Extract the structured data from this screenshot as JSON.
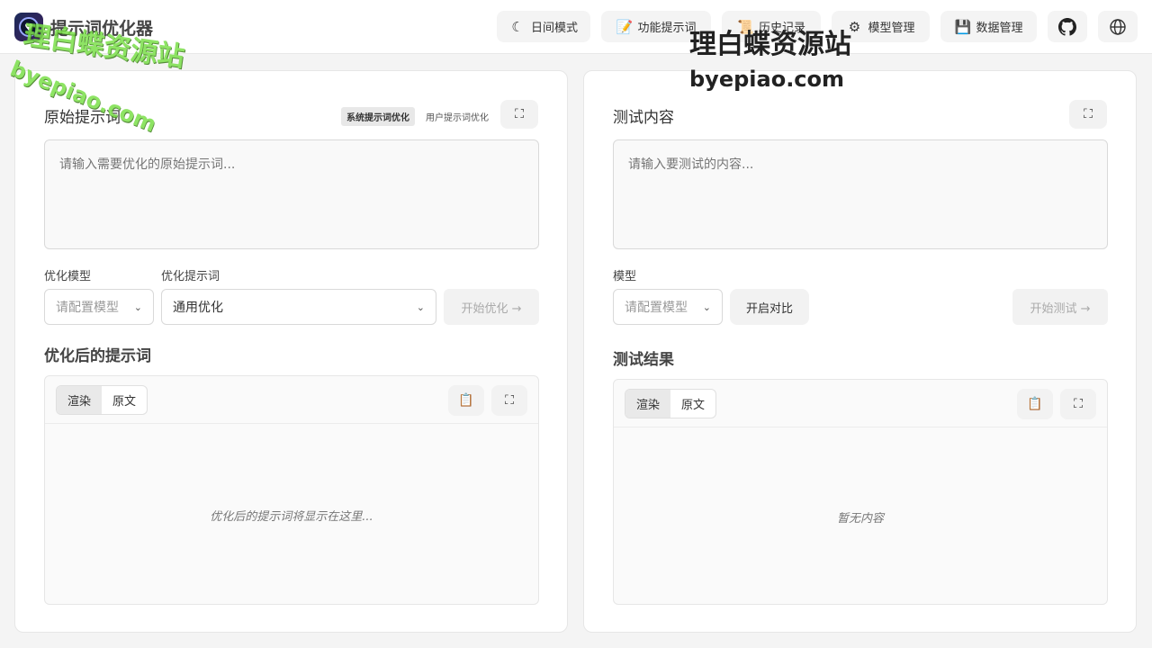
{
  "app": {
    "title": "提示词优化器"
  },
  "nav": {
    "day_mode": "日间模式",
    "feature_prompts": "功能提示词",
    "history": "历史记录",
    "model_manage": "模型管理",
    "data_manage": "数据管理"
  },
  "left": {
    "title": "原始提示词",
    "mode_tabs": [
      "系统提示词优化",
      "用户提示词优化"
    ],
    "input_placeholder": "请输入需要优化的原始提示词...",
    "model_label": "优化模型",
    "prompt_label": "优化提示词",
    "model_select": "请配置模型",
    "prompt_select": "通用优化",
    "start_button": "开始优化 →",
    "result_title": "优化后的提示词",
    "view_render": "渲染",
    "view_raw": "原文",
    "empty": "优化后的提示词将显示在这里..."
  },
  "right": {
    "title": "测试内容",
    "input_placeholder": "请输入要测试的内容...",
    "model_label": "模型",
    "model_select": "请配置模型",
    "compare_button": "开启对比",
    "start_button": "开始测试 →",
    "result_title": "测试结果",
    "view_render": "渲染",
    "view_raw": "原文",
    "empty": "暂无内容"
  },
  "watermark": {
    "text1": "理白蝶资源站",
    "text2": "byepiao.com"
  },
  "icons": {
    "moon": "moon-icon",
    "memo": "memo-icon",
    "scroll": "scroll-icon",
    "gear": "gear-icon",
    "floppy": "floppy-icon",
    "github": "github-icon",
    "globe": "globe-icon",
    "expand": "expand-icon",
    "clipboard": "clipboard-icon"
  },
  "colors": {
    "accent_watermark_green": "#7be04a",
    "dark_watermark": "#222222"
  }
}
